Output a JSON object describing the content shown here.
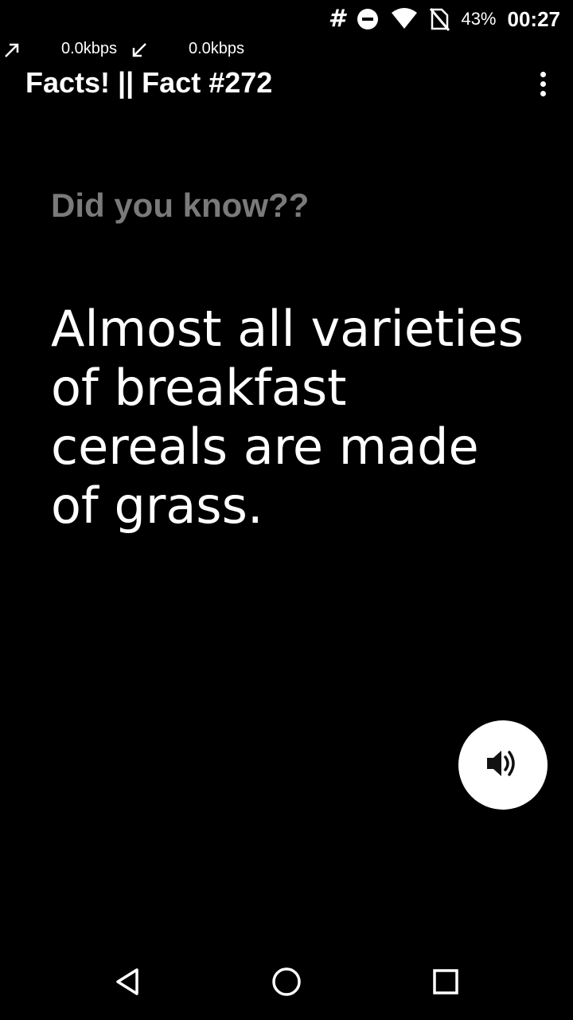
{
  "status_bar": {
    "notification_glyph": "#",
    "icons": [
      "do-not-disturb-icon",
      "wifi-icon",
      "no-sim-icon"
    ],
    "battery": "43%",
    "time": "00:27"
  },
  "network": {
    "upload_speed": "0.0kbps",
    "download_speed": "0.0kbps"
  },
  "app_bar": {
    "title": "Facts! || Fact #272",
    "menu_icon": "more-vert-icon"
  },
  "content": {
    "subtitle": "Did you know??",
    "fact": "Almost all varieties of breakfast cereals are made of grass."
  },
  "fab": {
    "icon": "speaker-icon"
  },
  "colors": {
    "background": "#000000",
    "text": "#ffffff",
    "subtitle": "#7a7a7a",
    "fab": "#ffffff"
  },
  "nav_bar": {
    "buttons": [
      "back-icon",
      "home-icon",
      "recents-icon"
    ]
  }
}
